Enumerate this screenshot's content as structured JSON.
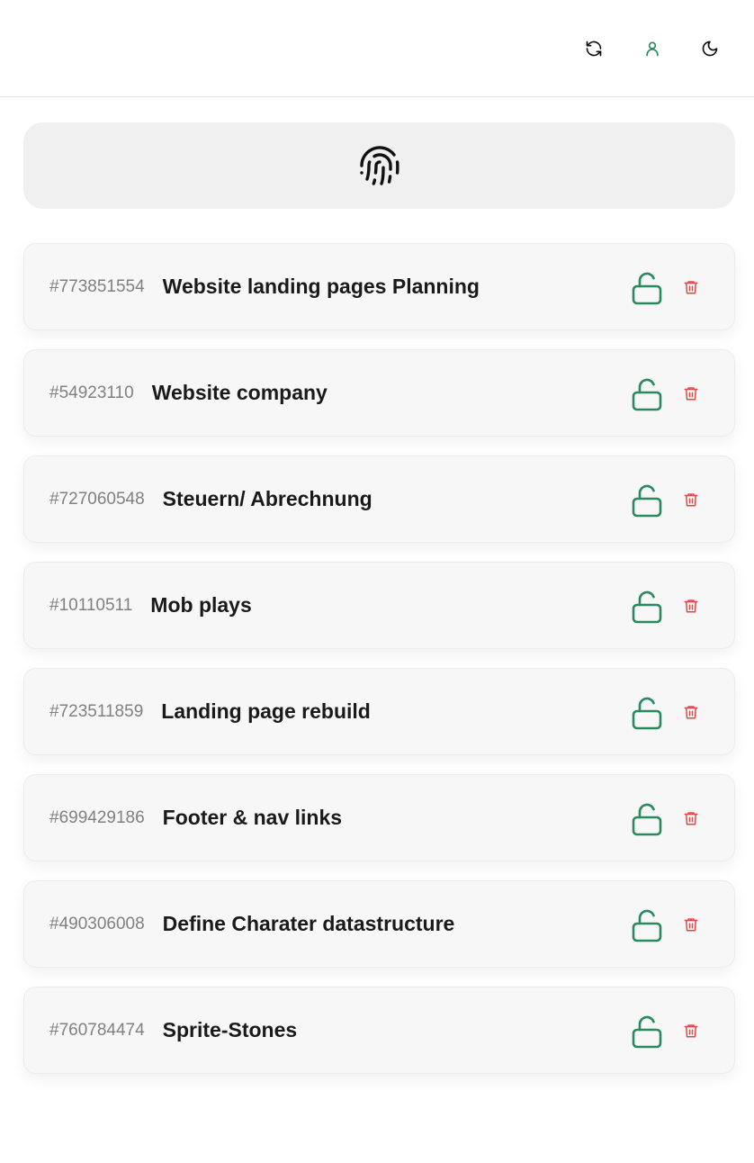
{
  "header": {
    "icons": [
      "refresh-icon",
      "user-icon",
      "moon-icon"
    ]
  },
  "auth": {
    "icon": "fingerprint-icon"
  },
  "colors": {
    "accent_green": "#2a8a5e",
    "danger_red": "#e04848",
    "card_bg": "#f7f7f7",
    "id_gray": "#808080"
  },
  "projects": [
    {
      "id": "#773851554",
      "title": "Website landing pages Planning"
    },
    {
      "id": "#54923110",
      "title": "Website company"
    },
    {
      "id": "#727060548",
      "title": "Steuern/ Abrechnung"
    },
    {
      "id": "#10110511",
      "title": "Mob plays"
    },
    {
      "id": "#723511859",
      "title": "Landing page rebuild"
    },
    {
      "id": "#699429186",
      "title": "Footer & nav links"
    },
    {
      "id": "#490306008",
      "title": "Define Charater datastructure"
    },
    {
      "id": "#760784474",
      "title": "Sprite-Stones"
    }
  ]
}
